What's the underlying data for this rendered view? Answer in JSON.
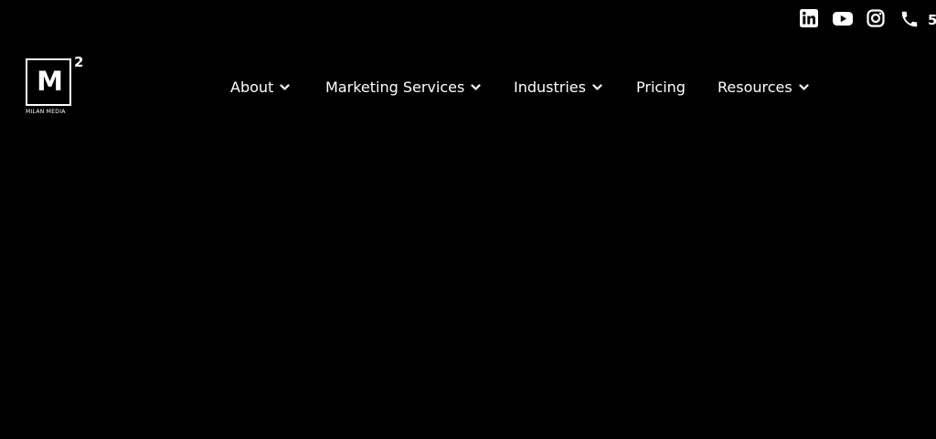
{
  "header": {
    "social": [
      {
        "icon": "linkedin-icon"
      },
      {
        "icon": "youtube-icon"
      },
      {
        "icon": "instagram-icon"
      },
      {
        "icon": "phone-icon"
      }
    ],
    "phone_partial": "5"
  },
  "logo": {
    "mark": "M",
    "superscript": "2",
    "name": "MILAN MEDIA"
  },
  "nav": {
    "items": [
      {
        "label": "About",
        "has_dropdown": true
      },
      {
        "label": "Marketing Services",
        "has_dropdown": true
      },
      {
        "label": "Industries",
        "has_dropdown": true
      },
      {
        "label": "Pricing",
        "has_dropdown": false
      },
      {
        "label": "Resources",
        "has_dropdown": true
      }
    ]
  },
  "colors": {
    "background": "#000000",
    "text": "#ffffff"
  }
}
